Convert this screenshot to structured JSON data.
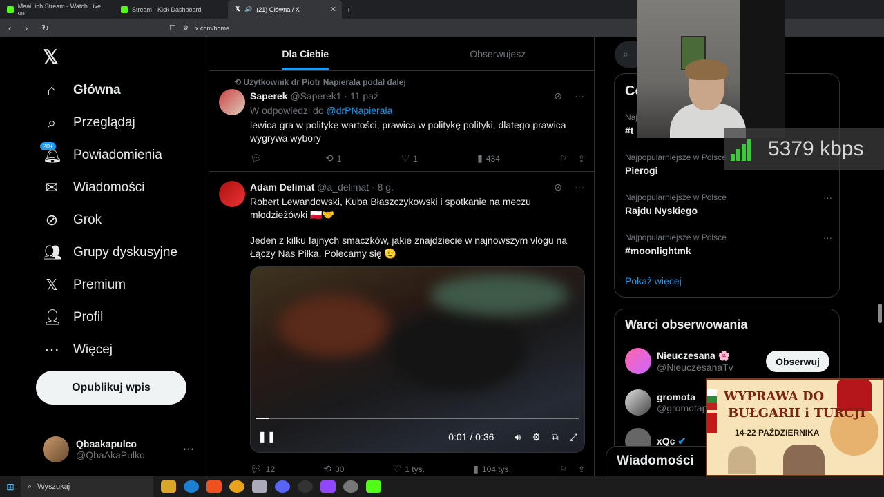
{
  "browser": {
    "tabs": [
      {
        "label": "MaaiLinh Stream - Watch Live on"
      },
      {
        "label": "Stream - Kick Dashboard"
      },
      {
        "label": "(21) Główna / X"
      }
    ],
    "url": "x.com/home"
  },
  "nav": {
    "items": [
      {
        "label": "Główna",
        "icon": "home-icon"
      },
      {
        "label": "Przeglądaj",
        "icon": "search-icon"
      },
      {
        "label": "Powiadomienia",
        "icon": "bell-icon",
        "badge": "20+"
      },
      {
        "label": "Wiadomości",
        "icon": "mail-icon"
      },
      {
        "label": "Grok",
        "icon": "grok-icon"
      },
      {
        "label": "Grupy dyskusyjne",
        "icon": "people-icon"
      },
      {
        "label": "Premium",
        "icon": "x-logo-icon"
      },
      {
        "label": "Profil",
        "icon": "person-icon"
      },
      {
        "label": "Więcej",
        "icon": "more-circle-icon"
      }
    ],
    "publish_label": "Opublikuj wpis",
    "profile": {
      "name": "Qbaakapulco",
      "handle": "@QbaAkaPulko"
    }
  },
  "feed": {
    "tabs": [
      {
        "label": "Dla Ciebie"
      },
      {
        "label": "Obserwujesz"
      }
    ],
    "posts": [
      {
        "repost_note": "Użytkownik dr Piotr Napierala podał dalej",
        "name": "Saperek",
        "handle": "@Saperek1",
        "time": "· 11 paź",
        "reply_prefix": "W odpowiedzi do",
        "reply_to": "@drPNapierala",
        "text": "lewica gra w politykę wartości, prawica w politykę polityki, dlatego prawica wygrywa wybory",
        "replies": "",
        "reposts": "1",
        "likes": "1",
        "views": "434"
      },
      {
        "name": "Adam Delimat",
        "handle": "@a_delimat",
        "time": "· 8 g.",
        "text1": "Robert Lewandowski, Kuba Błaszczykowski i spotkanie na meczu młodzieżówki 🇵🇱🤝",
        "text2": "Jeden z kilku fajnych smaczków, jakie znajdziecie w najnowszym vlogu na Łączy Nas Piłka. Polecamy się 🫡",
        "video": {
          "time": "0:01 / 0:36",
          "progress": 0.04
        },
        "replies": "12",
        "reposts": "30",
        "likes": "1 tys.",
        "views": "104 tys."
      }
    ]
  },
  "sidebar": {
    "trends_title": "Co",
    "trends": [
      {
        "meta": "Naj",
        "name": "#t"
      },
      {
        "meta": "Najpopularniejsze w Polsce",
        "name": "Pierogi"
      },
      {
        "meta": "Najpopularniejsze w Polsce",
        "name": "Rajdu Nyskiego"
      },
      {
        "meta": "Najpopularniejsze w Polsce",
        "name": "#moonlightmk"
      }
    ],
    "show_more": "Pokaż więcej",
    "follow_title": "Warci obserwowania",
    "follow": [
      {
        "name": "Nieuczesana 🌸",
        "handle": "@NieuczesanaTv"
      },
      {
        "name": "gromota",
        "handle": "@gromotap"
      },
      {
        "name": "xQc",
        "handle": ""
      }
    ],
    "follow_button": "Obserwuj",
    "messages_label": "Wiadomości"
  },
  "overlay": {
    "kbps": "5379 kbps",
    "banner_line1": "WYPRAWA DO",
    "banner_line2": "BUŁGARII i TURCJI",
    "banner_dates": "14-22 PAŹDZIERNIKA"
  },
  "taskbar": {
    "search_placeholder": "Wyszukaj"
  }
}
